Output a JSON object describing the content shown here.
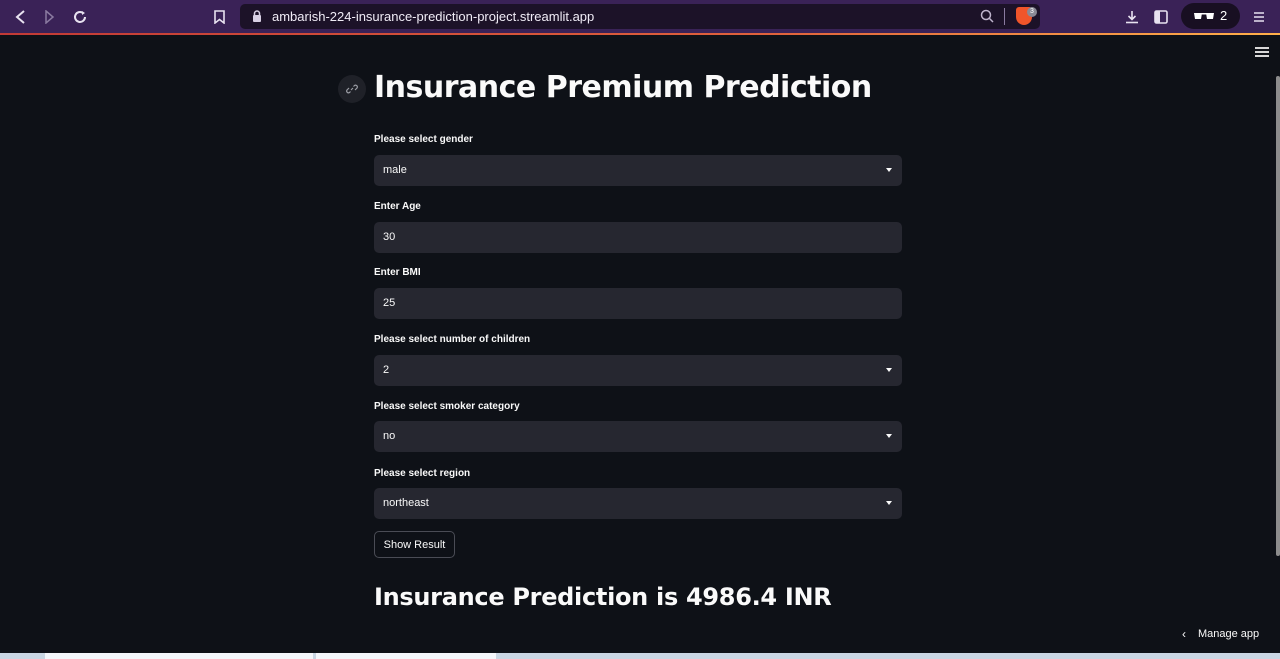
{
  "browser": {
    "url": "ambarish-224-insurance-prediction-project.streamlit.app",
    "shields_count": "3",
    "private_windows_count": "2",
    "icons": [
      "back-icon",
      "forward-icon",
      "reload-icon",
      "bookmark-icon",
      "lock-icon",
      "zoom-icon",
      "brave-shield-icon",
      "download-icon",
      "sidebar-icon",
      "glasses-icon",
      "menu-icon"
    ]
  },
  "app": {
    "title": "Insurance Premium Prediction",
    "fields": [
      {
        "label": "Please select gender",
        "value": "male",
        "type": "select"
      },
      {
        "label": "Enter Age",
        "value": "30",
        "type": "input"
      },
      {
        "label": "Enter BMI",
        "value": "25",
        "type": "input"
      },
      {
        "label": "Please select number of children",
        "value": "2",
        "type": "select"
      },
      {
        "label": "Please select smoker category",
        "value": "no",
        "type": "select"
      },
      {
        "label": "Please select region",
        "value": "northeast",
        "type": "select"
      }
    ],
    "button_label": "Show Result",
    "result_text": "Insurance Prediction is 4986.4 INR",
    "manage_app_label": "Manage app"
  },
  "colors": {
    "background": "#0e1117",
    "field_background": "#262730",
    "browser_bar": "#3a2257",
    "text": "#fafafa"
  }
}
